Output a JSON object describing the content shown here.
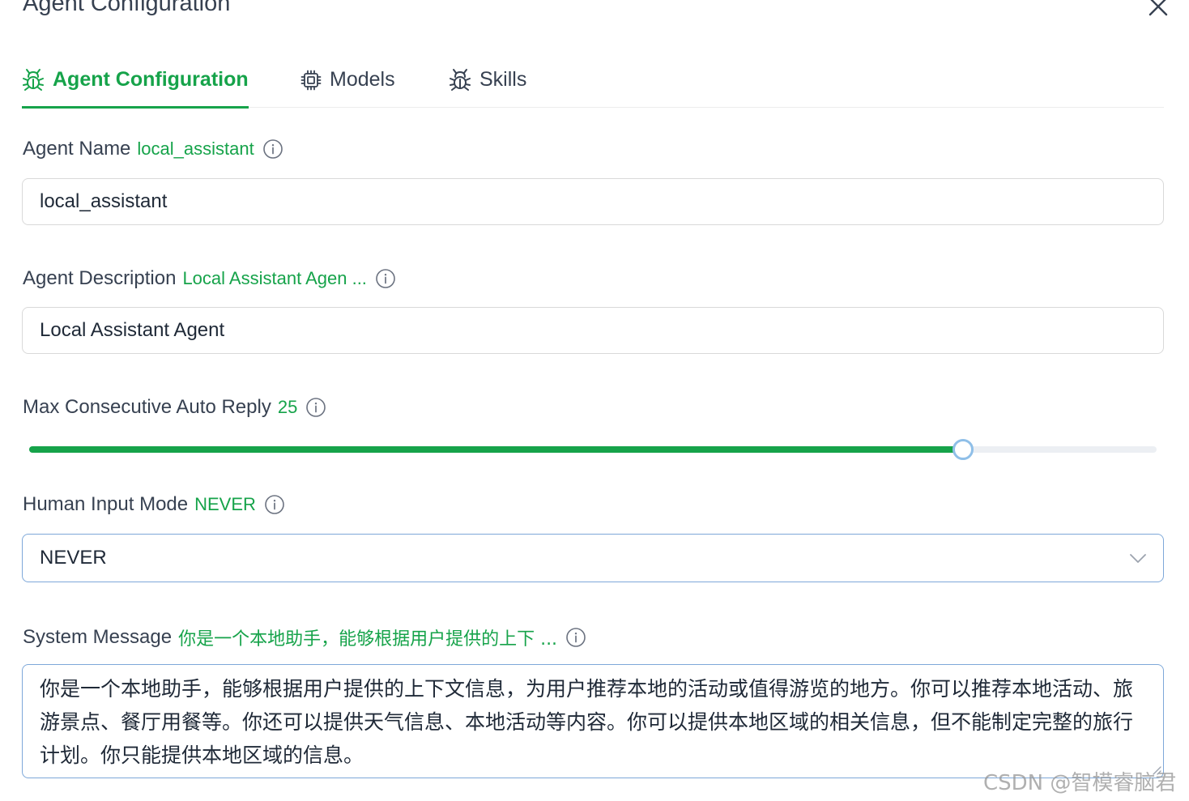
{
  "dialog": {
    "title": "Agent Configuration",
    "close_icon": "close-icon"
  },
  "tabs": [
    {
      "label": "Agent Configuration",
      "icon": "bug-icon",
      "active": true
    },
    {
      "label": "Models",
      "icon": "cpu-chip-icon",
      "active": false
    },
    {
      "label": "Skills",
      "icon": "bug-icon",
      "active": false
    }
  ],
  "agent_name": {
    "label": "Agent Name",
    "preview": "local_assistant",
    "value": "local_assistant"
  },
  "agent_description": {
    "label": "Agent Description",
    "preview": "Local Assistant Agen ...",
    "value": "Local Assistant Agent"
  },
  "max_auto_reply": {
    "label": "Max Consecutive Auto Reply",
    "preview": "25",
    "value": 25,
    "fraction": 0.828
  },
  "human_input_mode": {
    "label": "Human Input Mode",
    "preview": "NEVER",
    "selected": "NEVER"
  },
  "system_message": {
    "label": "System Message",
    "preview": "你是一个本地助手，能够根据用户提供的上下 ...",
    "value": "你是一个本地助手，能够根据用户提供的上下文信息，为用户推荐本地的活动或值得游览的地方。你可以推荐本地活动、旅游景点、餐厅用餐等。你还可以提供天气信息、本地活动等内容。你可以提供本地区域的相关信息，但不能制定完整的旅行计划。你只能提供本地区域的信息。"
  },
  "watermark": "CSDN @智模睿脑君",
  "colors": {
    "accent": "#16a34a",
    "text": "#374151",
    "border": "#d9d9d9",
    "focus_border": "#7ea8d9",
    "slider_handle": "#8fbfe8"
  }
}
